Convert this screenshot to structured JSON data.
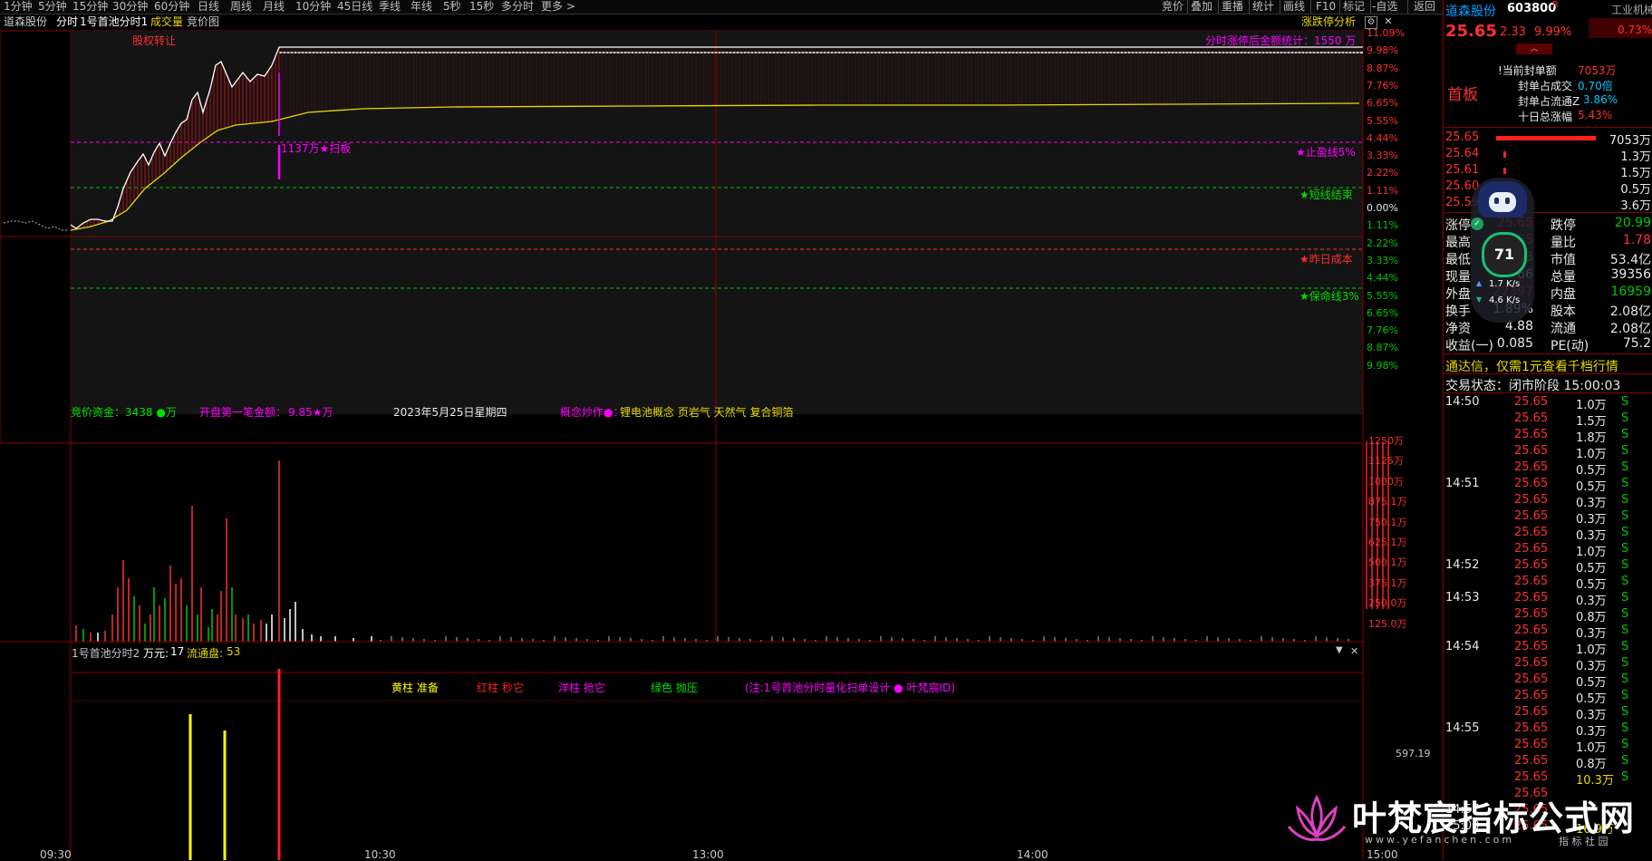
{
  "toolbar": {
    "tabs": [
      "1分钟",
      "5分钟",
      "15分钟",
      "30分钟",
      "60分钟",
      "日线",
      "周线",
      "月线",
      "10分钟",
      "45日线",
      "季线",
      "年线",
      "5秒",
      "15秒",
      "多分时",
      "更多 >"
    ],
    "right_buttons": [
      "竞价",
      "叠加",
      "重播",
      "统计",
      "画线",
      "F10",
      "标记",
      "-自选",
      "返回"
    ]
  },
  "chart_header": {
    "stock": "道森股份",
    "mode": "分时",
    "indicator": "1号首池分时1",
    "volume": "成交量",
    "auction": "竞价图",
    "tool": "涨跌停分析"
  },
  "price_chart": {
    "annotations": {
      "equity_change": "股权转让",
      "limit_stats": "分时涨停后金额统计：1550  万",
      "sweep": "1137万★扫板",
      "take_profit": "★止盈线5%",
      "short_end": "★短线结束",
      "yesterday_cost": "★昨日成本",
      "lifeline": "★保命线3%",
      "auction_funds_label": "竞价资金：",
      "auction_funds_value": "3438  ●万",
      "first_trade_label": "开盘第一笔金额：",
      "first_trade_value": "9.85★万",
      "date": "2023年5月25日星期四",
      "concept_label": "概念炒作●：",
      "concept_value": "锂电池概念 页岩气 天然气 复合铜箔"
    },
    "right_axis": [
      "11.09%",
      "9.98%",
      "8.87%",
      "7.76%",
      "6.65%",
      "5.55%",
      "4.44%",
      "3.33%",
      "2.22%",
      "1.11%",
      "0.00%",
      "1.11%",
      "2.22%",
      "3.33%",
      "4.44%",
      "5.55%",
      "6.65%",
      "7.76%",
      "8.87%",
      "9.98%"
    ],
    "volume_axis": [
      "1250万",
      "1125万",
      "1000万",
      "875.1万",
      "750.1万",
      "625.1万",
      "500.1万",
      "375.1万",
      "250.0万",
      "125.0万"
    ]
  },
  "sub_chart": {
    "title": "1号首池分时2",
    "wan_label": "万元:",
    "wan_value": "17",
    "float_label": "流通盘:",
    "float_value": "53",
    "legend": [
      "黄柱 准备",
      "红柱 秒它",
      "洋柱 抢它",
      "绿色 抛压",
      "(注:1号首池分时量化扫单设计 ● 叶梵宸ID)"
    ],
    "axis_value": "597.19"
  },
  "time_axis": [
    "09:30",
    "10:30",
    "13:00",
    "14:00",
    "15:00"
  ],
  "quote": {
    "name": "道森股份",
    "code": "603800",
    "code_flag": "R",
    "sector": "工业机械",
    "sector_change": "0.73%",
    "price": "25.65",
    "change": "2.33",
    "change_pct": "9.99%",
    "tag": "首板",
    "seal_amount_label": "!当前封单额",
    "seal_amount": "7053万",
    "seal_ratio_label": "封单占成交",
    "seal_ratio": "0.70倍",
    "seal_float_label": "封单占流通Z",
    "seal_float": "3.86%",
    "ten_day_label": "十日总涨幅",
    "ten_day": "5.43%",
    "bids": [
      {
        "price": "25.65",
        "vol": "7053万"
      },
      {
        "price": "25.64",
        "vol": "1.3万"
      },
      {
        "price": "25.61",
        "vol": "1.5万"
      },
      {
        "price": "25.60",
        "vol": "0.5万"
      },
      {
        "price": "25.59",
        "vol": "3.6万"
      }
    ],
    "stats": [
      {
        "l1": "涨停",
        "v1": "25.65",
        "l2": "跌停",
        "v2": "20.99"
      },
      {
        "l1": "最高",
        "v1": "25.65",
        "l2": "量比",
        "v2": "1.78"
      },
      {
        "l1": "最低",
        "v1": "23.23",
        "l2": "市值",
        "v2": "53.4亿"
      },
      {
        "l1": "现量",
        "v1": "66",
        "l2": "总量",
        "v2": "39356"
      },
      {
        "l1": "外盘",
        "v1": "22397",
        "l2": "内盘",
        "v2": "16959"
      },
      {
        "l1": "换手",
        "v1": "1.89%",
        "l2": "股本",
        "v2": "2.08亿"
      },
      {
        "l1": "净资",
        "v1": "4.88",
        "l2": "流通",
        "v2": "2.08亿"
      },
      {
        "l1": "收益(一)",
        "v1": "0.085",
        "l2": "PE(动)",
        "v2": "75.2"
      }
    ],
    "promo": "通达信，仅需1元查看千档行情",
    "status_label": "交易状态：",
    "status_value": "闭市阶段 15:00:03",
    "speed_score": "71",
    "speed_up": "1.7 K/s",
    "speed_down": "4.6 K/s"
  },
  "trades": [
    {
      "time": "14:50",
      "price": "25.65",
      "vol": "1.0万",
      "bs": "S"
    },
    {
      "time": "",
      "price": "25.65",
      "vol": "1.5万",
      "bs": "S"
    },
    {
      "time": "",
      "price": "25.65",
      "vol": "1.8万",
      "bs": "S"
    },
    {
      "time": "",
      "price": "25.65",
      "vol": "1.0万",
      "bs": "S"
    },
    {
      "time": "",
      "price": "25.65",
      "vol": "0.5万",
      "bs": "S"
    },
    {
      "time": "14:51",
      "price": "25.65",
      "vol": "0.5万",
      "bs": "S"
    },
    {
      "time": "",
      "price": "25.65",
      "vol": "0.3万",
      "bs": "S"
    },
    {
      "time": "",
      "price": "25.65",
      "vol": "0.3万",
      "bs": "S"
    },
    {
      "time": "",
      "price": "25.65",
      "vol": "0.3万",
      "bs": "S"
    },
    {
      "time": "",
      "price": "25.65",
      "vol": "1.0万",
      "bs": "S"
    },
    {
      "time": "14:52",
      "price": "25.65",
      "vol": "0.5万",
      "bs": "S"
    },
    {
      "time": "",
      "price": "25.65",
      "vol": "0.5万",
      "bs": "S"
    },
    {
      "time": "14:53",
      "price": "25.65",
      "vol": "0.3万",
      "bs": "S"
    },
    {
      "time": "",
      "price": "25.65",
      "vol": "0.8万",
      "bs": "S"
    },
    {
      "time": "",
      "price": "25.65",
      "vol": "0.3万",
      "bs": "S"
    },
    {
      "time": "14:54",
      "price": "25.65",
      "vol": "1.0万",
      "bs": "S"
    },
    {
      "time": "",
      "price": "25.65",
      "vol": "0.3万",
      "bs": "S"
    },
    {
      "time": "",
      "price": "25.65",
      "vol": "0.5万",
      "bs": "S"
    },
    {
      "time": "",
      "price": "25.65",
      "vol": "0.5万",
      "bs": "S"
    },
    {
      "time": "",
      "price": "25.65",
      "vol": "0.3万",
      "bs": "S"
    },
    {
      "time": "14:55",
      "price": "25.65",
      "vol": "0.3万",
      "bs": "S"
    },
    {
      "time": "",
      "price": "25.65",
      "vol": "1.0万",
      "bs": "S"
    },
    {
      "time": "",
      "price": "25.65",
      "vol": "0.8万",
      "bs": "S"
    },
    {
      "time": "",
      "price": "25.65",
      "vol": "10.3万",
      "bs": "S"
    },
    {
      "time": "",
      "price": "25.65",
      "vol": "",
      "bs": ""
    },
    {
      "time": "14:57",
      "price": "25.65",
      "vol": "",
      "bs": ""
    },
    {
      "time": "15:00",
      "price": "25.65",
      "vol": "16.9万",
      "bs": ""
    }
  ],
  "watermark": {
    "text": "叶梵宸指标公式网",
    "url": "www.yefanchen.com",
    "sub": "指 标 社 园"
  },
  "colors": {
    "price_up": "#ff3030",
    "avg_line": "#e8d800",
    "price_line": "#ffffff",
    "magenta": "#ff00ff",
    "green_dash": "#00c800",
    "axis_red": "#ff3030"
  }
}
